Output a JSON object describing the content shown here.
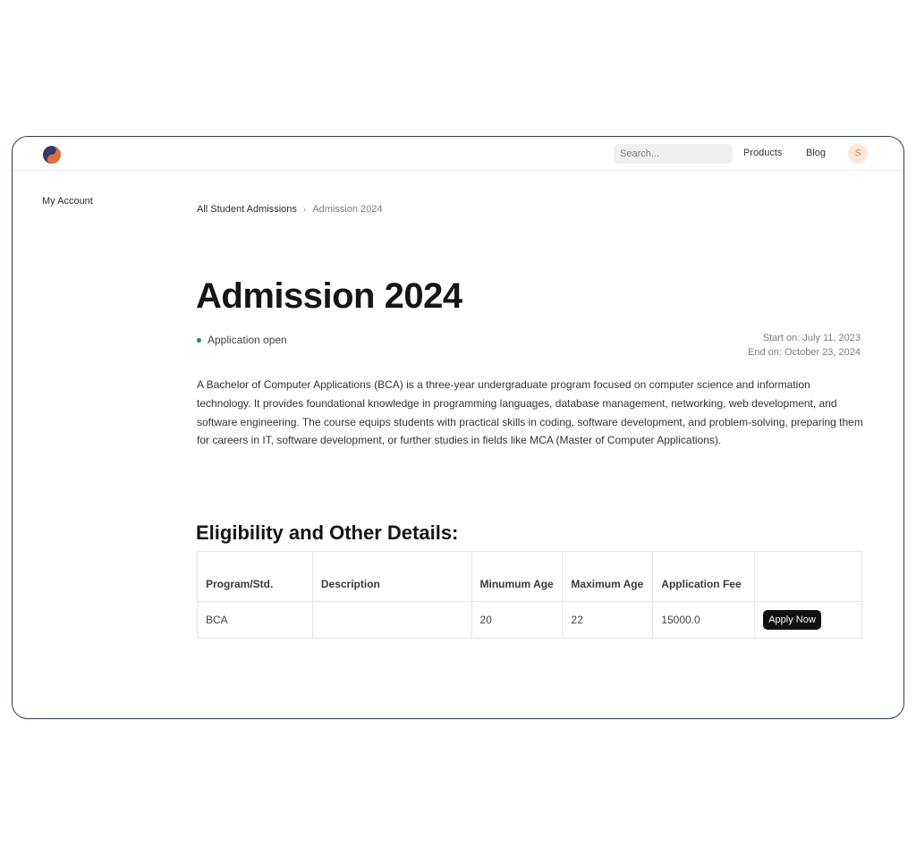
{
  "navbar": {
    "search_placeholder": "Search...",
    "links": [
      "Products",
      "Blog"
    ],
    "avatar_initial": "S",
    "brand_colors": {
      "primary": "#2f3b6b",
      "accent": "#e36e35"
    }
  },
  "sidebar": {
    "items": [
      {
        "label": "My Account"
      }
    ]
  },
  "breadcrumb": {
    "parent": "All Student Admissions",
    "separator": "›",
    "current": "Admission 2024"
  },
  "page": {
    "title": "Admission 2024",
    "status": "Application open",
    "status_color": "#1e8e5a",
    "start": "Start on: July 11, 2023",
    "end": "End on: October 23, 2024",
    "description": "A Bachelor of Computer Applications (BCA) is a three-year undergraduate program focused on computer science and information technology. It provides foundational knowledge in programming languages, database management, networking, web development, and software engineering. The course equips students with practical skills in coding, software development, and problem-solving, preparing them for careers in IT, software development, or further studies in fields like MCA (Master of Computer Applications)."
  },
  "details": {
    "title": "Eligibility and Other Details:",
    "columns": [
      "Program/Std.",
      "Description",
      "Minumum Age",
      "Maximum Age",
      "Application Fee",
      ""
    ],
    "rows": [
      {
        "program": "BCA",
        "description": "",
        "min_age": "20",
        "max_age": "22",
        "fee": "15000.0",
        "action": "Apply Now"
      }
    ]
  }
}
